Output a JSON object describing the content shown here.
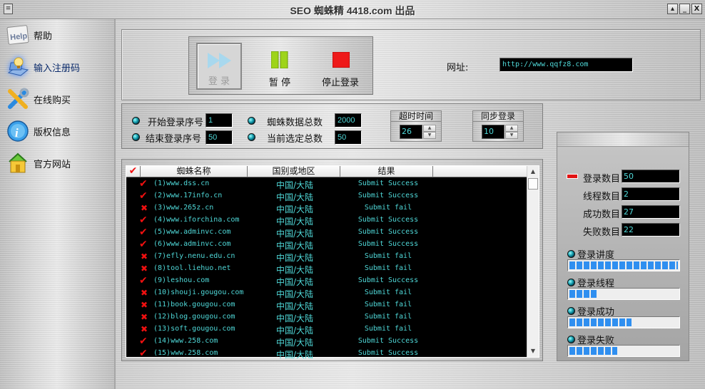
{
  "window": {
    "title": "SEO 蜘蛛精 4418.com 出品",
    "sys_menu_icon": "system-menu-icon",
    "buttons": [
      {
        "name": "restore",
        "glyph": "▴"
      },
      {
        "name": "minimize",
        "glyph": "_"
      },
      {
        "name": "close",
        "glyph": "X"
      }
    ]
  },
  "sidebar": {
    "items": [
      {
        "label": "帮助",
        "icon": "help-icon",
        "active": false
      },
      {
        "label": "输入注册码",
        "icon": "register-code-icon",
        "active": true
      },
      {
        "label": "在线购买",
        "icon": "tools-icon",
        "active": false
      },
      {
        "label": "版权信息",
        "icon": "info-icon",
        "active": false
      },
      {
        "label": "官方网站",
        "icon": "home-icon",
        "active": false
      }
    ]
  },
  "controls": {
    "login": {
      "label": "登 录",
      "icon": "fast-forward-icon",
      "enabled": false
    },
    "pause": {
      "label": "暂 停",
      "icon": "pause-icon",
      "enabled": true
    },
    "stop": {
      "label": "停止登录",
      "icon": "stop-icon",
      "enabled": true
    }
  },
  "url": {
    "label": "网址:",
    "value": "http://www.qqfz8.com"
  },
  "params": {
    "start_index": {
      "label": "开始登录序号",
      "value": "1"
    },
    "end_index": {
      "label": "结束登录序号",
      "value": "50"
    },
    "total_spiders": {
      "label": "蜘蛛数据总数",
      "value": "2000"
    },
    "selected_total": {
      "label": "当前选定总数",
      "value": "50"
    },
    "timeout": {
      "label": "超时时间",
      "value": "26"
    },
    "sync_login": {
      "label": "同步登录",
      "value": "10"
    }
  },
  "table": {
    "columns": [
      "",
      "蜘蛛名称",
      "国别或地区",
      "结果",
      ""
    ],
    "rows": [
      {
        "status": "success",
        "name": "(1)www.dss.cn",
        "region": "中国/大陆",
        "result": "Submit Success"
      },
      {
        "status": "success",
        "name": "(2)www.17info.cn",
        "region": "中国/大陆",
        "result": "Submit Success"
      },
      {
        "status": "fail",
        "name": "(3)www.265z.cn",
        "region": "中国/大陆",
        "result": "Submit fail"
      },
      {
        "status": "success",
        "name": "(4)www.iforchina.com",
        "region": "中国/大陆",
        "result": "Submit Success"
      },
      {
        "status": "success",
        "name": "(5)www.adminvc.com",
        "region": "中国/大陆",
        "result": "Submit Success"
      },
      {
        "status": "success",
        "name": "(6)www.adminvc.com",
        "region": "中国/大陆",
        "result": "Submit Success"
      },
      {
        "status": "fail",
        "name": "(7)efly.nenu.edu.cn",
        "region": "中国/大陆",
        "result": "Submit fail"
      },
      {
        "status": "fail",
        "name": "(8)tool.liehuo.net",
        "region": "中国/大陆",
        "result": "Submit fail"
      },
      {
        "status": "success",
        "name": "(9)leshou.com",
        "region": "中国/大陆",
        "result": "Submit Success"
      },
      {
        "status": "fail",
        "name": "(10)shouji.gougou.com",
        "region": "中国/大陆",
        "result": "Submit fail"
      },
      {
        "status": "fail",
        "name": "(11)book.gougou.com",
        "region": "中国/大陆",
        "result": "Submit fail"
      },
      {
        "status": "fail",
        "name": "(12)blog.gougou.com",
        "region": "中国/大陆",
        "result": "Submit fail"
      },
      {
        "status": "fail",
        "name": "(13)soft.gougou.com",
        "region": "中国/大陆",
        "result": "Submit fail"
      },
      {
        "status": "success",
        "name": "(14)www.258.com",
        "region": "中国/大陆",
        "result": "Submit Success"
      },
      {
        "status": "success",
        "name": "(15)www.258.com",
        "region": "中国/大陆",
        "result": "Submit Success"
      }
    ]
  },
  "stats": {
    "login_count": {
      "label": "登录数目",
      "value": "50"
    },
    "thread_count": {
      "label": "线程数目",
      "value": "2"
    },
    "success_count": {
      "label": "成功数目",
      "value": "27"
    },
    "fail_count": {
      "label": "失败数目",
      "value": "22"
    }
  },
  "progress": [
    {
      "label": "登录讲度",
      "percent": 100
    },
    {
      "label": "登录线程",
      "percent": 25
    },
    {
      "label": "登录成功",
      "percent": 57
    },
    {
      "label": "登录失败",
      "percent": 44
    }
  ],
  "colors": {
    "accent_text": "#4fd8d8",
    "mark_red": "#f01010",
    "progress_blue": "#2f8ff0"
  }
}
